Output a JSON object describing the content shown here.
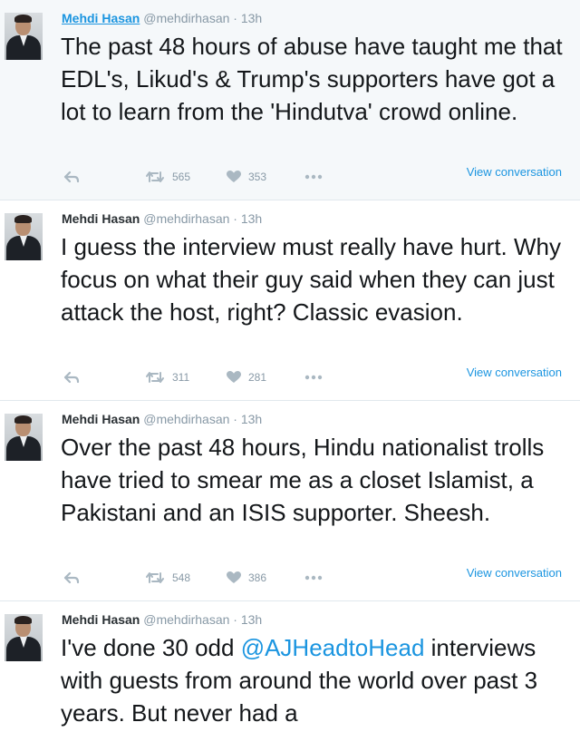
{
  "tweets": [
    {
      "name": "Mehdi Hasan",
      "handle": "@mehdirhasan",
      "dot": "·",
      "time": "13h",
      "text": "The past 48 hours of abuse have taught me that EDL's, Likud's & Trump's supporters have got a lot to learn from the 'Hindutva' crowd online.",
      "retweets": "565",
      "likes": "353",
      "view_label": "View conversation"
    },
    {
      "name": "Mehdi Hasan",
      "handle": "@mehdirhasan",
      "dot": "·",
      "time": "13h",
      "text": "I guess the interview must really have hurt. Why focus on what their guy said when they can just attack the host, right? Classic evasion.",
      "retweets": "311",
      "likes": "281",
      "view_label": "View conversation"
    },
    {
      "name": "Mehdi Hasan",
      "handle": "@mehdirhasan",
      "dot": "·",
      "time": "13h",
      "text": "Over the past 48 hours, Hindu nationalist trolls have tried to smear me as a closet Islamist, a Pakistani and an ISIS supporter. Sheesh.",
      "retweets": "548",
      "likes": "386",
      "view_label": "View conversation"
    },
    {
      "name": "Mehdi Hasan",
      "handle": "@mehdirhasan",
      "dot": "·",
      "time": "13h",
      "text_before": "I've done 30 odd ",
      "mention": "@AJHeadtoHead",
      "text_after": " interviews with guests from around the world over past 3 years. But never had a"
    }
  ],
  "icons": {
    "reply": "reply-arrow-icon",
    "retweet": "retweet-icon",
    "like": "heart-icon",
    "more": "more-dots-icon"
  },
  "colors": {
    "accent": "#1b95e0",
    "muted": "#8899a6",
    "highlight_bg": "#f5f8fa"
  }
}
